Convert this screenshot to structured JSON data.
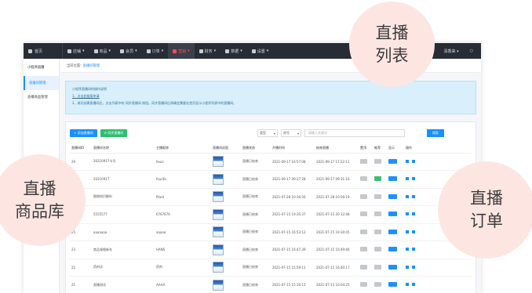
{
  "topbar": {
    "home": "首页",
    "menus": [
      "店铺",
      "商品",
      "会员",
      "订单",
      "营销",
      "财务",
      "数据",
      "设置"
    ],
    "active_index": 4,
    "user": "清香来",
    "extra": "○"
  },
  "sidebar": {
    "header": "小程序直播",
    "items": [
      "直播间管理",
      "直播商品管理"
    ],
    "active_index": 0
  },
  "breadcrumb": {
    "label": "当前位置:",
    "current": "直播间管理"
  },
  "notice": {
    "title": "小程序直播间的操作说明",
    "line1": "1、点击此链接申请",
    "line2": "2、成功创建直播间后，点击列表中的 同步直播间 按钮。同步直播间后再确定需要在首页显示小程序列表中的直播间。"
  },
  "toolbar": {
    "add_label": "+ 添加直播间",
    "sync_label": "⟳ 同步直播间"
  },
  "search": {
    "select1": "类型",
    "select2": "房号",
    "placeholder": "请输入关键词",
    "button": "搜索"
  },
  "table": {
    "headers": [
      "直播间ID",
      "直播间名称",
      "主播昵称",
      "直播间封面",
      "直播状态",
      "开播时间",
      "结束直播",
      "置顶",
      "推荐",
      "显示",
      "操作"
    ],
    "rows": [
      {
        "id": "29",
        "name": "20210917卡号",
        "anchor": "feuis",
        "status": "直播已结束",
        "start": "2021-09-17 16:57:08",
        "end": "2021-09-17 17:22:11",
        "rec": "gray"
      },
      {
        "id": "28",
        "name": "20210917",
        "anchor": "feuiitis",
        "status": "直播已结束",
        "start": "2021-09-17 09:27:28",
        "end": "2021-09-17 09:31:16",
        "rec": "green"
      },
      {
        "id": "27",
        "name": "植物知识解析",
        "anchor": "Plant",
        "status": "直播已结束",
        "start": "2021-07-28 10:36:56",
        "end": "2021-07-28 10:56:19",
        "rec": "gray"
      },
      {
        "id": "26",
        "name": "5555577",
        "anchor": "6767676",
        "status": "直播已结束",
        "start": "2021-07-15 19:35:37",
        "end": "2021-07-15 20:12:48",
        "rec": "gray"
      },
      {
        "id": "25",
        "name": "aaaaaaa",
        "anchor": "aaaaa",
        "status": "直播已结束",
        "start": "2021-07-15 16:53:12",
        "end": "2021-07-15 19:30:45",
        "rec": "gray"
      },
      {
        "id": "23",
        "name": "商品规格新车",
        "anchor": "HANS",
        "status": "直播已结束",
        "start": "2021-07-15 16:47:39",
        "end": "2021-07-15 16:49:46",
        "rec": "gray"
      },
      {
        "id": "22",
        "name": "药剂试",
        "anchor": "药剂",
        "status": "直播已结束",
        "start": "2021-07-15 15:59:11",
        "end": "2021-07-15 16:40:17",
        "rec": "gray"
      },
      {
        "id": "21",
        "name": "直播测试",
        "anchor": "AAAA",
        "status": "直播已结束",
        "start": "2021-07-15 15:10:15",
        "end": "2021-07-15 16:04:25",
        "rec": "gray"
      }
    ],
    "show_label": "显示"
  },
  "bubbles": {
    "top_right": [
      "直播",
      "列表"
    ],
    "left": [
      "直播",
      "商品库"
    ],
    "bottom_right": [
      "直播",
      "订单"
    ]
  },
  "colors": {
    "accent": "#1890ff",
    "active_menu": "#ff4d4f",
    "bubble": "#fde6e2",
    "topbar": "#282c35"
  }
}
